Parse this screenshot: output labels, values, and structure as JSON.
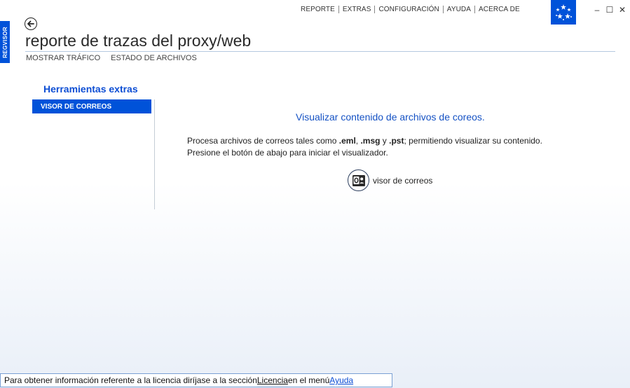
{
  "app": {
    "side_tab_label": "REGVISOR"
  },
  "top_menu": {
    "items": [
      "REPORTE",
      "EXTRAS",
      "CONFIGURACIÓN",
      "AYUDA",
      "ACERCA DE"
    ]
  },
  "window_controls": {
    "minimize": "–",
    "maximize": "☐",
    "close": "✕"
  },
  "header": {
    "title": "reporte de trazas del proxy/web",
    "subnav": [
      "MOSTRAR TRÁFICO",
      "ESTADO DE ARCHIVOS"
    ]
  },
  "sidebar": {
    "heading": "Herramientas extras",
    "items": [
      {
        "label": "VISOR DE CORREOS",
        "selected": true
      }
    ]
  },
  "main": {
    "heading": "Visualizar contenido de archivos de coreos.",
    "desc_part1": "Procesa archivos de correos tales como ",
    "ext_eml": ".eml",
    "comma": ", ",
    "ext_msg": ".msg",
    "and": " y ",
    "ext_pst": ".pst",
    "desc_part2": "; permitiendo visualizar su contenido.",
    "desc_line2": "Presione el botón de abajo para iniciar el visualizador.",
    "button_label": "visor de correos",
    "button_icon": "outlook-icon"
  },
  "status": {
    "text_before": "Para obtener información referente a la licencia diríjase a la sección ",
    "licencia": "Licencia",
    "text_middle": " en el menú ",
    "ayuda": "Ayuda"
  },
  "colors": {
    "accent": "#0052d9",
    "heading_blue": "#1552c4"
  }
}
